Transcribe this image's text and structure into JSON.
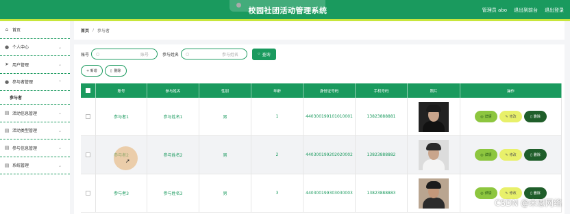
{
  "header": {
    "app_title": "校园社团活动管理系统",
    "user_label": "管理员 abo",
    "exit_front_label": "退出到前台",
    "logout_label": "退出登录"
  },
  "sidebar": {
    "items": [
      {
        "label": "首页",
        "icon": "home-icon"
      },
      {
        "label": "个人中心",
        "icon": "user-icon"
      },
      {
        "label": "用户管理",
        "icon": "send-icon"
      },
      {
        "label": "参与者管理",
        "icon": "user-icon"
      },
      {
        "label": "参与者",
        "icon": ""
      },
      {
        "label": "活动信息管理",
        "icon": "list-icon"
      },
      {
        "label": "活动类型管理",
        "icon": "list-icon"
      },
      {
        "label": "参与信息管理",
        "icon": "list-icon"
      },
      {
        "label": "系统管理",
        "icon": "list-icon"
      }
    ]
  },
  "breadcrumb": {
    "home": "首页",
    "separator": "/",
    "current": "参与者"
  },
  "search": {
    "account_label": "账号",
    "account_placeholder": "账号",
    "name_label": "参与姓名",
    "name_placeholder": "参与姓名",
    "search_button": "查询"
  },
  "actions": {
    "add": "+ 新增",
    "delete": "删除"
  },
  "table": {
    "columns": [
      "账号",
      "参与姓名",
      "性别",
      "年龄",
      "身份证号码",
      "手机号码",
      "照片",
      "操作"
    ],
    "ops": {
      "detail": "详情",
      "edit": "修改",
      "delete": "删除"
    },
    "rows": [
      {
        "account": "参与者1",
        "name": "参与姓名1",
        "gender": "男",
        "age": "1",
        "id_number": "440300199101010001",
        "phone": "13823888881"
      },
      {
        "account": "参与者2",
        "name": "参与姓名2",
        "gender": "男",
        "age": "2",
        "id_number": "440300199202020002",
        "phone": "13823888882"
      },
      {
        "account": "参与者3",
        "name": "参与姓名3",
        "gender": "男",
        "age": "3",
        "id_number": "440300199303030003",
        "phone": "13823888883"
      }
    ]
  },
  "watermark": "CSDN @米恩网络",
  "colors": {
    "primary": "#1a9a5e",
    "accent": "#c8e63c",
    "detail": "#8dc63f",
    "edit": "#e8f06a",
    "danger": "#1f5e2a"
  }
}
